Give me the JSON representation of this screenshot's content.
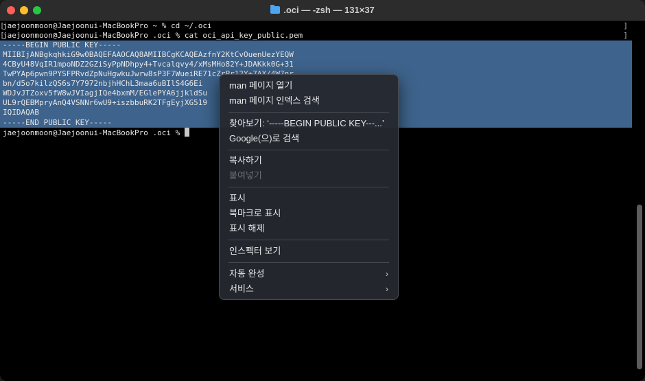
{
  "window": {
    "title": ".oci — -zsh — 131×37"
  },
  "terminal": {
    "lines": [
      "jaejoonmoon@Jaejoonui-MacBookPro ~ % cd ~/.oci",
      "jaejoonmoon@Jaejoonui-MacBookPro .oci % cat oci_api_key_public.pem",
      "-----BEGIN PUBLIC KEY-----",
      "MIIBIjANBgkqhkiG9w0BAQEFAAOCAQ8AMIIBCgKCAQEAzfnY2KtCvOuenUezYEQW",
      "4CByU48VqIR1mpoNDZ2GZiSyPpNDhpy4+Tvcalqvy4/xMsMHo82Y+JDAKkk0G+31",
      "TwPYAp6pwn9PYSFPRvdZpNuHgwkuJwrw8sP3F7WueiRE71cZrPr12Y+7AX/4W7nr",
      "bn/d5o7kilzQS6s7Y7972nbjhHChL3maa6uBIlS4G6Ei",
      "WDJvJTZoxv5fW8wJVIagjIQe4bxmM/EGlePYA6jjkldSu",
      "UL9rQEBMpryAnQ4VSNNr6wU9+iszbbuRK2TFgEyjXG519",
      "IQIDAQAB",
      "-----END PUBLIC KEY-----",
      "jaejoonmoon@Jaejoonui-MacBookPro .oci % "
    ],
    "bracket_left": "[",
    "bracket_right": "]"
  },
  "context_menu": {
    "items": {
      "man_open": "man 페이지 열기",
      "man_index": "man 페이지 인덱스 검색",
      "lookup": "찾아보기: ‘-----BEGIN PUBLIC KEY---...’",
      "google": "Google(으)로 검색",
      "copy": "복사하기",
      "paste": "붙여넣기",
      "show": "표시",
      "bookmark": "북마크로 표시",
      "unshow": "표시 해제",
      "inspector": "인스펙터 보기",
      "autocomplete": "자동 완성",
      "services": "서비스"
    },
    "chevron": "›"
  },
  "colors": {
    "selection": "#3e638c",
    "menu_bg": "#24282f"
  }
}
